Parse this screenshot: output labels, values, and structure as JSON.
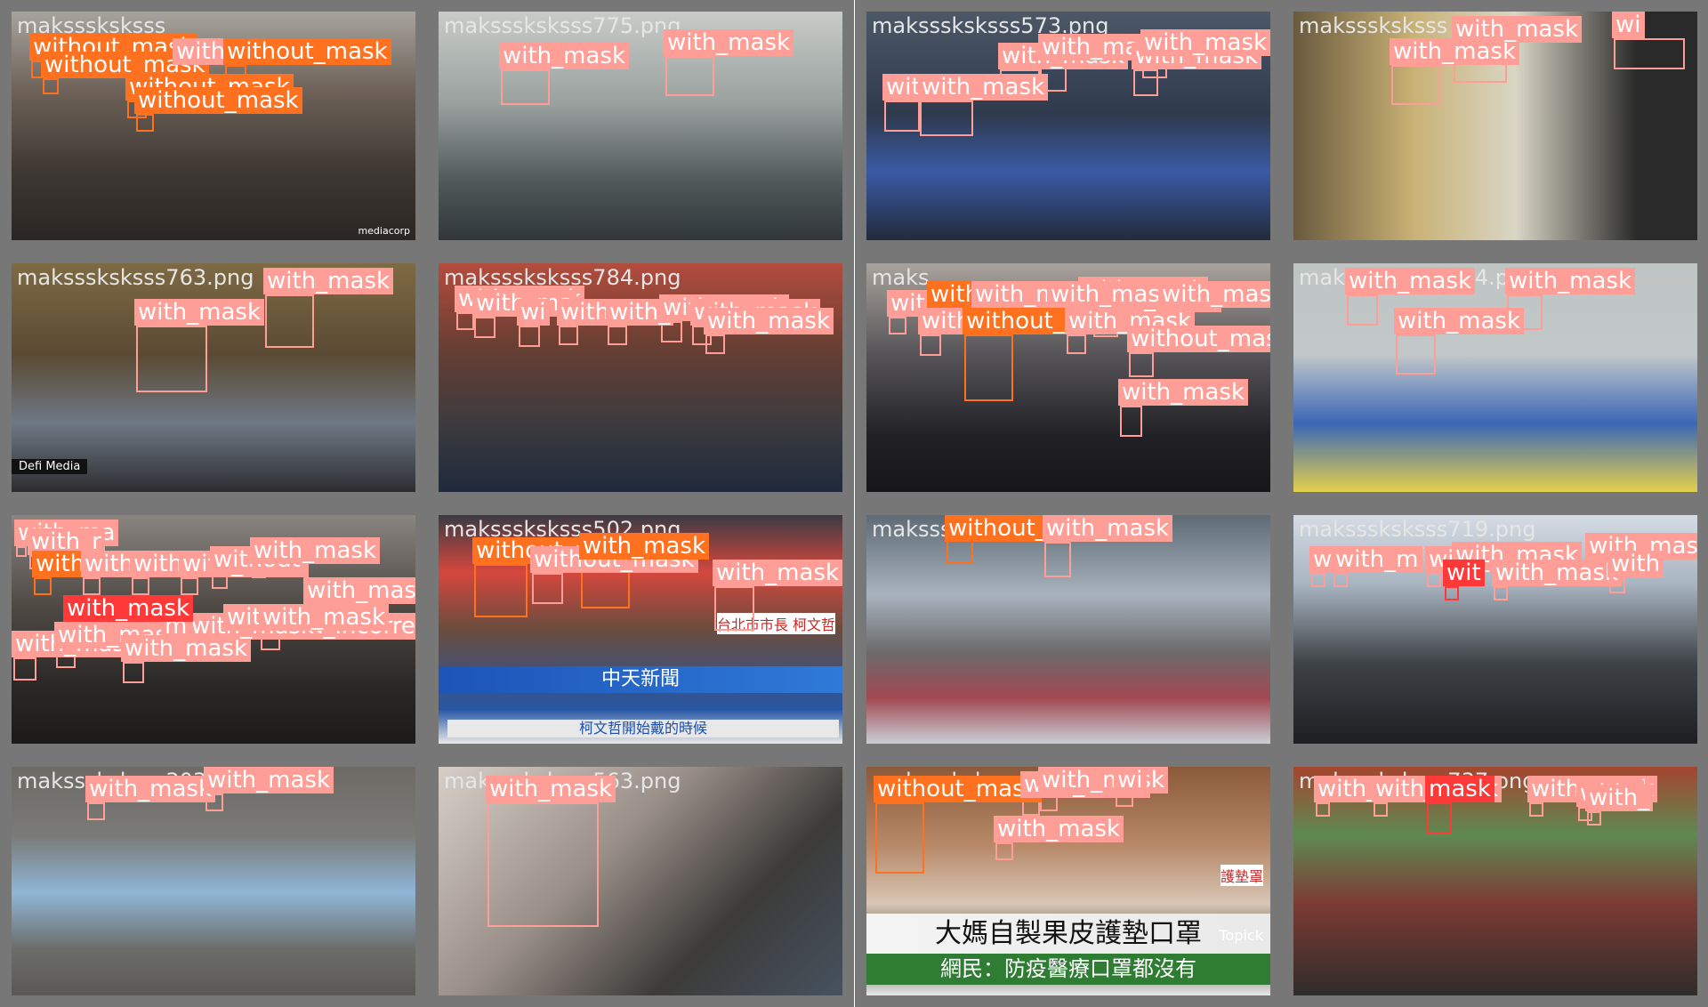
{
  "colors": {
    "with_mask": "#ff9d97",
    "without_mask": "#ff701f",
    "mask_weared_incorrect": "#ff3838",
    "grid_bg": "#777777"
  },
  "tiles": [
    {
      "filename": "maksssksksss",
      "labels": [
        "without_mask",
        "without_mask",
        "without_mask",
        "with_",
        "without_mask",
        "without_mask"
      ],
      "watermark": "mediacorp"
    },
    {
      "filename": "maksssksksss775.png",
      "labels": [
        "with_mask",
        "with_mask"
      ]
    },
    {
      "filename": "maksssksksss573.png",
      "labels": [
        "with_mask",
        "with_mask",
        "with_mask",
        "with_mask",
        "with_mask",
        "with_mask"
      ]
    },
    {
      "filename": "maksssksksss",
      "labels": [
        "with_mask",
        "with_mask",
        "wi"
      ]
    },
    {
      "filename": "maksssksksss763.png",
      "labels": [
        "with_mask",
        "with_mask"
      ],
      "watermark": "Defi Media"
    },
    {
      "filename": "maksssksksss784.png",
      "labels": [
        "with_mask",
        "with_ma",
        "wi",
        "with_",
        "with_",
        "with_mask",
        "with_mask",
        "with_mask"
      ]
    },
    {
      "filename": "maks",
      "labels": [
        "with_mask",
        "with_mask",
        "with_mask",
        "with_mask",
        "without_mask",
        "with_mask",
        "with_mask",
        "without_mask",
        "with_mask",
        "with_mask",
        "with_mask",
        "with_mask"
      ]
    },
    {
      "filename": "maksssksksss774.png",
      "labels": [
        "with_mask",
        "with_mask",
        "with_mask"
      ]
    },
    {
      "filename": "w",
      "labels": [
        "with_ma",
        "with_r",
        "with_mask",
        "with_mask",
        "with_mask",
        "with_mask",
        "without",
        "with_mask",
        "with_mask",
        "with_mask",
        "with_mask",
        "with_mask",
        "mask_weared_incorrect",
        "with_mask",
        "with_mask",
        "with_mask",
        "with_mask"
      ]
    },
    {
      "filename": "maksssksksss502.png",
      "labels": [
        "without_mask",
        "without_mask",
        "with_mask",
        "with_mask"
      ],
      "overlay_texts": [
        "中天新聞",
        "柯文哲開始戴的時候",
        "台北市市長 柯文哲"
      ]
    },
    {
      "filename": "maksssks",
      "labels": [
        "without_mask",
        "with_mask"
      ]
    },
    {
      "filename": "maksssksksss719.png",
      "labels": [
        "with_ma",
        "with_m",
        "with_mask",
        "with_mask",
        "wit",
        "with_mask",
        "with_mas",
        "with"
      ]
    },
    {
      "filename": "maksssksksss303.png",
      "labels": [
        "with_mask",
        "with_mask"
      ]
    },
    {
      "filename": "maksssksksss563.png",
      "labels": [
        "with_mask"
      ]
    },
    {
      "filename": "maksssksksss62",
      "labels": [
        "without_mask",
        "with_mask",
        "with_mask",
        "with_mask",
        "wi"
      ],
      "overlay_texts": [
        "大媽自製果皮護墊口罩",
        "網民：防疫醫療口罩都沒有",
        "護墊罩",
        "Topick"
      ]
    },
    {
      "filename": "maksssksksss737.png",
      "labels": [
        "with_mask",
        "with_mask",
        "mask",
        "with_mask",
        "with_",
        "with_"
      ]
    }
  ]
}
